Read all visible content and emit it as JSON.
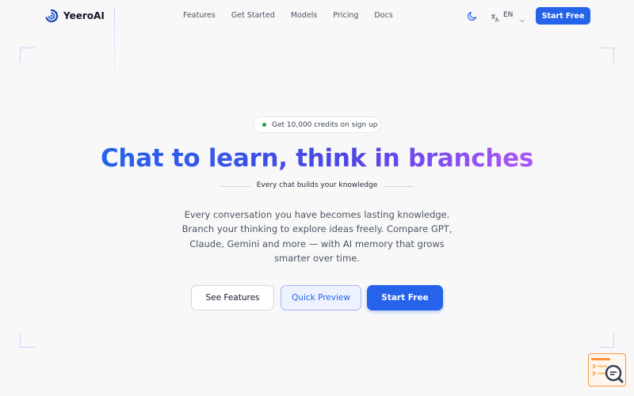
{
  "header": {
    "brand": "YeeroAI",
    "nav": [
      "Features",
      "Get Started",
      "Models",
      "Pricing",
      "Docs"
    ],
    "language": "EN",
    "cta": "Start Free"
  },
  "hero": {
    "badge": "Get 10,000 credits on sign up",
    "headline": "Chat to learn, think in branches",
    "tagline": "Every chat builds your knowledge",
    "description": "Every conversation you have becomes lasting knowledge. Branch your thinking to explore ideas freely. Compare GPT, Claude, Gemini and more — with AI memory that grows smarter over time.",
    "buttons": {
      "features": "See Features",
      "preview": "Quick Preview",
      "start": "Start Free"
    }
  },
  "icons": {
    "brand": "swirl-logo-icon",
    "theme": "moon-icon",
    "language": "translate-icon",
    "dropdown": "chevron-down-icon",
    "floating": "search-log-icon"
  },
  "colors": {
    "accent": "#2563eb",
    "gradient_start": "#2563eb",
    "gradient_end": "#a855f7",
    "badge_dot": "#16a34a",
    "floating_accent": "#fb923c"
  }
}
